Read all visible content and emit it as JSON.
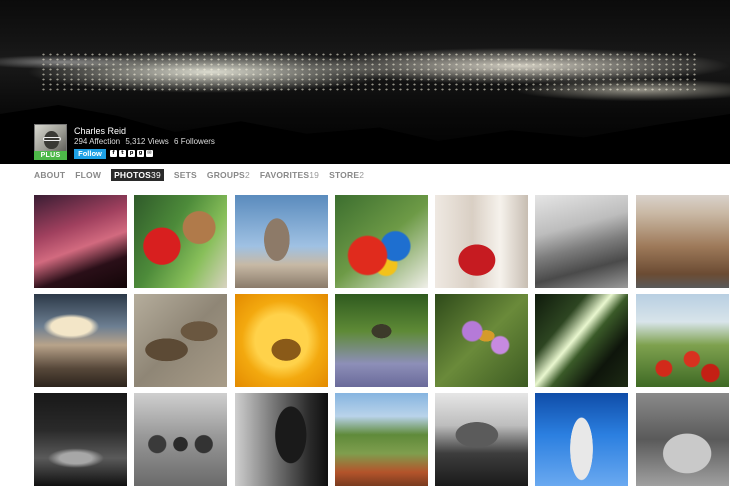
{
  "profile": {
    "name": "Charles Reid",
    "affection": "294 Affection",
    "views": "5,312 Views",
    "followers": "6 Followers",
    "badge": "PLUS",
    "follow_label": "Follow",
    "share_icons": [
      "facebook-icon",
      "twitter-icon",
      "pinterest-icon",
      "googleplus-icon",
      "email-icon"
    ]
  },
  "nav": {
    "about": {
      "label": "ABOUT",
      "count": ""
    },
    "flow": {
      "label": "FLOW",
      "count": ""
    },
    "photos": {
      "label": "PHOTOS",
      "count": "39"
    },
    "sets": {
      "label": "SETS",
      "count": ""
    },
    "groups": {
      "label": "GROUPS",
      "count": "2"
    },
    "favorites": {
      "label": "FAVORITES",
      "count": "19"
    },
    "store": {
      "label": "STORE",
      "count": "2"
    }
  },
  "colors": {
    "accent": "#1ea1e6",
    "plus_badge": "#4db848",
    "active_tab": "#2a2a2a"
  },
  "photos": [
    "pink-dusk-club-sign",
    "parrot-with-man",
    "colonial-dome-tower",
    "man-holding-macaws",
    "red-tricycle",
    "bw-coastline",
    "colonial-building-street",
    "cloudy-city-rooftops",
    "ducks-on-rocks",
    "bee-in-yellow-flower",
    "fly-on-lavender",
    "bee-on-purple-flowers",
    "glowing-tubes",
    "red-poppy-field",
    "bw-city-night",
    "bw-three-men",
    "bw-concert-crowd",
    "green-valley-landscape",
    "bw-drummer-hands",
    "blue-sky-monument",
    "bw-statue-hand"
  ]
}
